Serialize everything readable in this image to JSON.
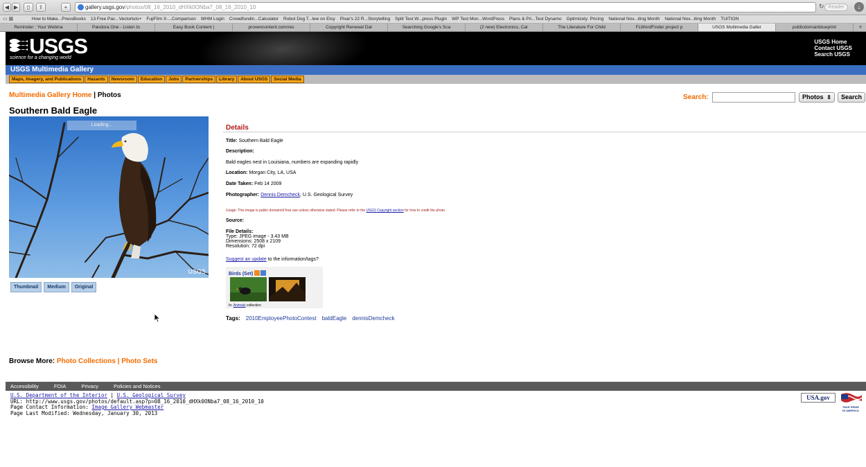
{
  "browser": {
    "url_domain": "gallery.usgs.gov",
    "url_rest": "/photos/08_16_2010_dHXk0ONba7_08_16_2010_10",
    "reader_label": "Reader",
    "bookmarks": [
      "How to Make...PressBooks",
      "13 Free Pac...Vectortuts+",
      "FujiFilm X-...Comparison",
      "WHM Login",
      "Crowdfundin...Calculator",
      "Robot Dog T...lew on Etsy",
      "Pixar's 22 R...Storytelling",
      "Split Test W...press Plugin",
      "WP Test Mon...WordPress",
      "Plans & Pri...Test Dynamo",
      "Optimizely: Pricing",
      "National Nov...iting Month",
      "National Nov...iting Month",
      "TUITION"
    ],
    "tabs": [
      "Reminder : Your Webina",
      "Pandora One - Listen to",
      "Easy Book Content |",
      "provencontent.com/res",
      "Copyright Renewal Dat",
      "Searching Google's Sca",
      "(2 new) Electronics, Car",
      "The Literature For Child",
      "FLWordFinder project p",
      "USGS Multimedia Galler",
      "publicdomainblueprint"
    ],
    "active_tab_index": 9
  },
  "header": {
    "logo_text": "USGS",
    "tagline": "science for a changing world",
    "links": [
      "USGS Home",
      "Contact USGS",
      "Search USGS"
    ],
    "gallery_title": "USGS Multimedia Gallery",
    "nav": [
      "Maps, Imagery, and Publications",
      "Hazards",
      "Newsroom",
      "Education",
      "Jobs",
      "Partnerships",
      "Library",
      "About USGS",
      "Social Media"
    ]
  },
  "page": {
    "breadcrumb_home": "Multimedia Gallery Home",
    "breadcrumb_sep": " | ",
    "breadcrumb_current": "Photos",
    "title": "Southern Bald Eagle",
    "search_label": "Search:",
    "search_select": "Photos",
    "search_button": "Search",
    "loading_text": "Loading...",
    "watermark": "USGS",
    "size_buttons": [
      "Thumbnail",
      "Medium",
      "Original"
    ]
  },
  "details": {
    "heading": "Details",
    "title_label": "Title:",
    "title_value": "Southern Bald Eagle",
    "description_label": "Description:",
    "description_value": "Bald eagles nest in Louisiana, numbers are expanding rapidly",
    "location_label": "Location:",
    "location_value": "Morgan City, LA, USA",
    "date_label": "Date Taken:",
    "date_value": "Feb 14 2009",
    "photographer_label": "Photographer:",
    "photographer_link": "Dennis Demcheck",
    "photographer_org": ", U.S. Geological Survey",
    "usage_prefix": "Usage: This image is public domain/of free use unless otherwise stated. Please refer to the ",
    "usage_link": "USGS Copyright section",
    "usage_suffix": " for how to credit the photo.",
    "source_label": "Source:",
    "file_details_label": "File Details:",
    "file_type": "Type: JPEG image - 3.43 MB",
    "file_dimensions": "Dimensions: 2508 x 2109",
    "file_resolution": "Resolution: 72 dpi",
    "suggest_link": "Suggest an update",
    "suggest_suffix": " to the information/tags?",
    "set_title": "Birds (Set)",
    "set_caption_prefix": "In: ",
    "set_caption_link": "Animals",
    "set_caption_suffix": " collection",
    "tags_label": "Tags:",
    "tags": [
      "2010EmployeePhotoContest",
      "baldEagle",
      "dennisDemcheck"
    ]
  },
  "browse": {
    "label": "Browse More: ",
    "collections": "Photo Collections",
    "sep": " | ",
    "sets": "Photo Sets"
  },
  "footer": {
    "links": [
      "Accessibility",
      "FOIA",
      "Privacy",
      "Policies and Notices"
    ],
    "doi_link": "U.S. Department of the Interior",
    "sep": " | ",
    "usgs_link": "U.S. Geological Survey",
    "url_line": "URL: http://www.usgs.gov/photos/default.asp?p=08_16_2010_dHXk0ONba7_08_16_2010_10",
    "contact_prefix": "Page Contact Information: ",
    "contact_link": "Image Gallery Webmaster",
    "modified": "Page Last Modified: Wednesday, January 30, 2013",
    "usagov_label": "USA.gov",
    "pride_label": "TAKE PRIDE IN AMERICA"
  }
}
